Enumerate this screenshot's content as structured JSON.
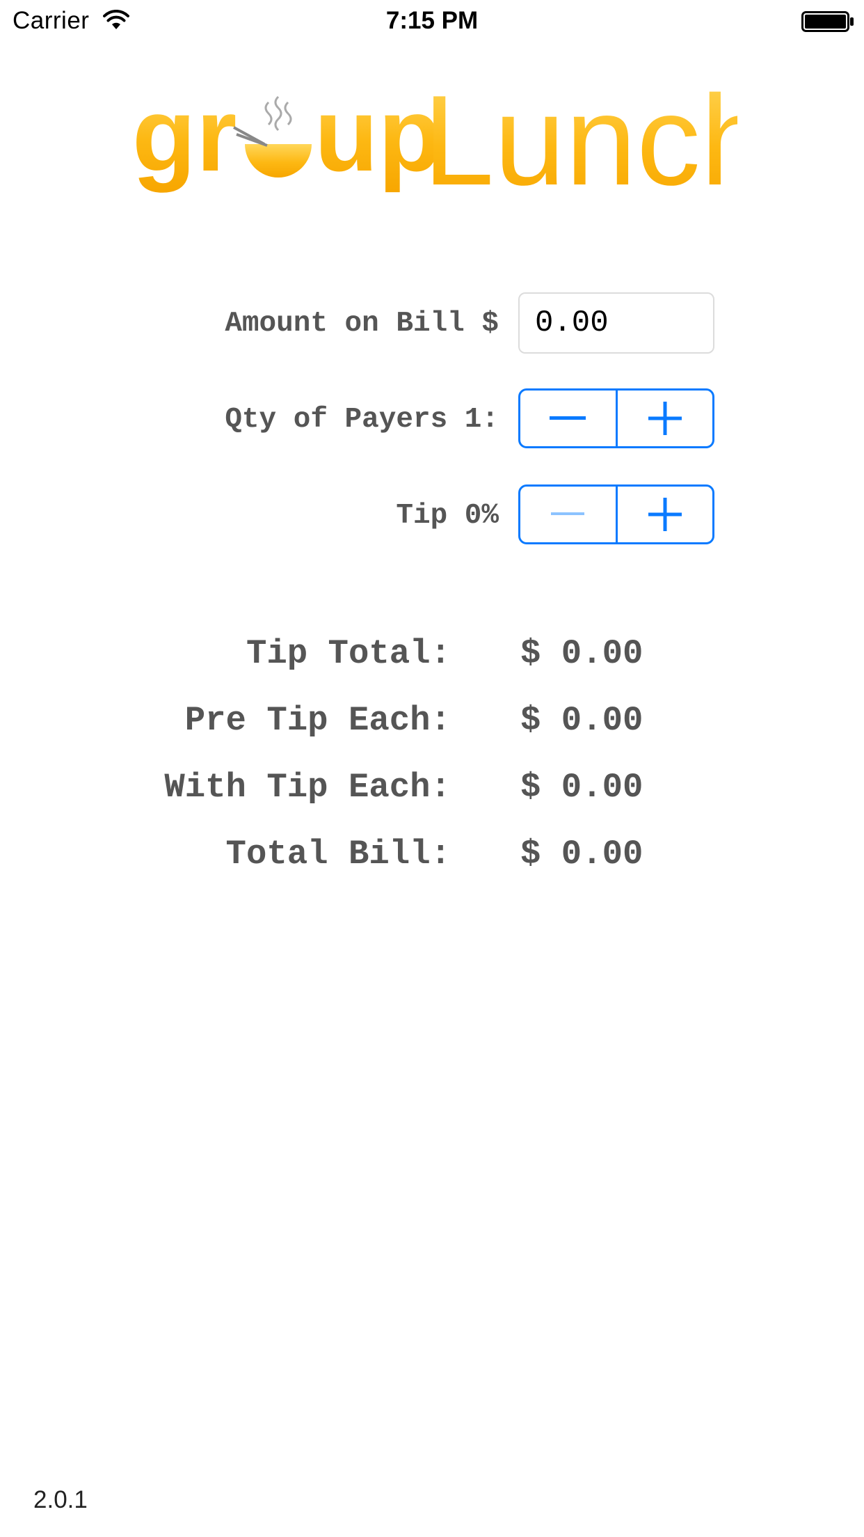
{
  "status_bar": {
    "carrier": "Carrier",
    "time": "7:15 PM",
    "wifi_icon": "wifi-icon",
    "battery_icon": "battery-icon"
  },
  "logo": {
    "text_group": "group",
    "text_lunch": "Lunch",
    "color": "#fdb813"
  },
  "form": {
    "amount_label": "Amount on Bill $",
    "amount_value": "0.00",
    "payers_label": "Qty of Payers 1:",
    "tip_label": "Tip 0%",
    "minus_icon": "minus-icon",
    "plus_icon": "plus-icon"
  },
  "results": {
    "tip_total_label": "Tip Total:",
    "tip_total_value": "$ 0.00",
    "pre_tip_each_label": "Pre Tip Each:",
    "pre_tip_each_value": "$ 0.00",
    "with_tip_each_label": "With Tip Each:",
    "with_tip_each_value": "$ 0.00",
    "total_bill_label": "Total Bill:",
    "total_bill_value": "$ 0.00"
  },
  "version": "2.0.1",
  "colors": {
    "accent": "#0a7aff",
    "accent_disabled": "#8cc3ff",
    "label_gray": "#555555",
    "logo_orange": "#fdb813"
  }
}
